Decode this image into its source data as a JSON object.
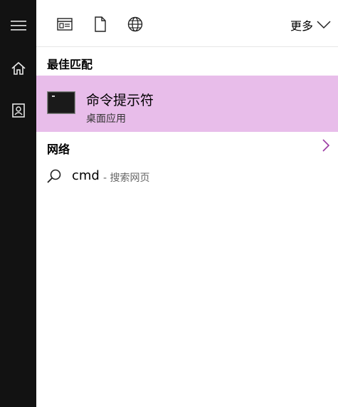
{
  "toolbar": {
    "more_label": "更多"
  },
  "sections": {
    "best_match_title": "最佳匹配",
    "network_title": "网络"
  },
  "best_match": {
    "title": "命令提示符",
    "subtitle": "桌面应用"
  },
  "web_search": {
    "query": "cmd",
    "hint": "- 搜索网页"
  },
  "colors": {
    "rail_bg": "#121212",
    "highlight": "#e8bdea",
    "accent_chevron": "#9b3aa3"
  }
}
